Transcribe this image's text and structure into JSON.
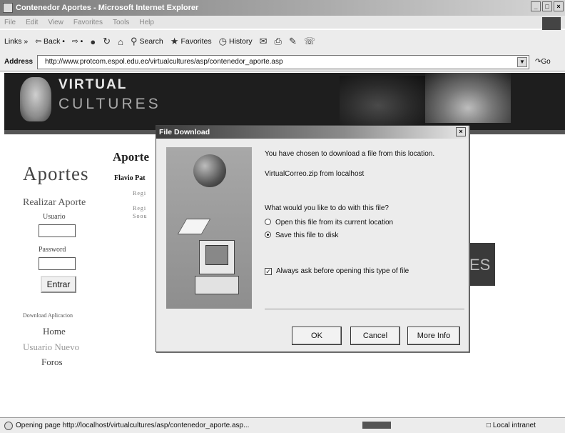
{
  "window": {
    "title": "Contenedor Aportes - Microsoft Internet Explorer",
    "controls": [
      "_",
      "□",
      "×"
    ]
  },
  "menubar": {
    "items": [
      "File",
      "Edit",
      "View",
      "Favorites",
      "Tools",
      "Help"
    ]
  },
  "toolbar": {
    "links_label": "Links »",
    "back_label": "⇦ Back •",
    "forward_label": "⇨ •",
    "search_label": "Search",
    "favorites_label": "Favorites",
    "history_label": "History"
  },
  "address": {
    "label": "Address",
    "url": "http://www.protcom.espol.edu.ec/virtualcultures/asp/contenedor_aporte.asp",
    "go_label": "Go"
  },
  "banner": {
    "line1": "VIRTUAL",
    "line2": "CULTURES"
  },
  "nav": {
    "title": "Aportes",
    "section": "Realizar Aporte",
    "usuario_label": "Usuario",
    "password_label": "Password",
    "entrar_label": "Entrar",
    "download_label": "Download Aplicacion",
    "home_label": "Home",
    "nuevo_label": "Usuario Nuevo",
    "foros_label": "Foros"
  },
  "content": {
    "heading": "Aporte",
    "subheading": "Flavio Pat",
    "row1": "Regi",
    "row2": "Regi",
    "row3": "Soou"
  },
  "right_box_text": "ES",
  "dialog": {
    "title": "File Download",
    "close": "×",
    "line1": "You have chosen to download a file from this location.",
    "filename": "VirtualCorreo.zip from localhost",
    "question": "What would you like to do with this file?",
    "option_open": "Open this file from its current location",
    "option_save": "Save this file to disk",
    "selected_option": "save",
    "always_ask": "Always ask before opening this type of file",
    "always_ask_checked": true,
    "ok_label": "OK",
    "cancel_label": "Cancel",
    "more_label": "More Info"
  },
  "status": {
    "text": "Opening page http://localhost/virtualcultures/asp/contenedor_aporte.asp...",
    "zone": "Local intranet"
  }
}
